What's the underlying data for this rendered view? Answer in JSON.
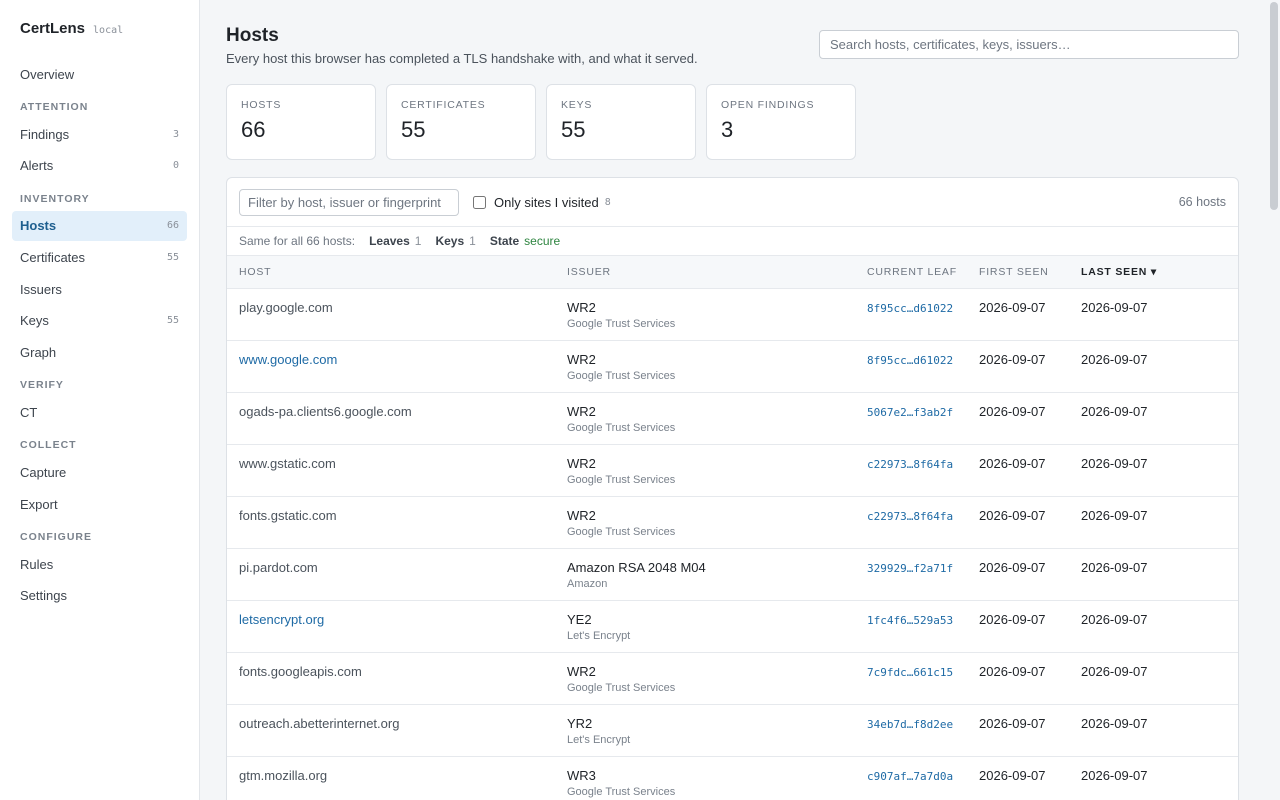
{
  "app": {
    "name": "CertLens",
    "tag": "local"
  },
  "sidebar": {
    "overview": "Overview",
    "sections": [
      {
        "title": "ATTENTION",
        "items": [
          {
            "label": "Findings",
            "count": "3"
          },
          {
            "label": "Alerts",
            "count": "0"
          }
        ]
      },
      {
        "title": "INVENTORY",
        "items": [
          {
            "label": "Hosts",
            "count": "66",
            "active": true
          },
          {
            "label": "Certificates",
            "count": "55"
          },
          {
            "label": "Issuers",
            "count": ""
          },
          {
            "label": "Keys",
            "count": "55"
          },
          {
            "label": "Graph",
            "count": ""
          }
        ]
      },
      {
        "title": "VERIFY",
        "items": [
          {
            "label": "CT",
            "count": ""
          }
        ]
      },
      {
        "title": "COLLECT",
        "items": [
          {
            "label": "Capture",
            "count": ""
          },
          {
            "label": "Export",
            "count": ""
          }
        ]
      },
      {
        "title": "CONFIGURE",
        "items": [
          {
            "label": "Rules",
            "count": ""
          },
          {
            "label": "Settings",
            "count": ""
          }
        ]
      }
    ]
  },
  "header": {
    "title": "Hosts",
    "subtitle": "Every host this browser has completed a TLS handshake with, and what it served.",
    "search_placeholder": "Search hosts, certificates, keys, issuers…"
  },
  "stats": [
    {
      "label": "HOSTS",
      "value": "66"
    },
    {
      "label": "CERTIFICATES",
      "value": "55"
    },
    {
      "label": "KEYS",
      "value": "55"
    },
    {
      "label": "OPEN FINDINGS",
      "value": "3"
    }
  ],
  "toolbar": {
    "filter_placeholder": "Filter by host, issuer or fingerprint",
    "visited_label": "Only sites I visited",
    "visited_count": "8",
    "host_total": "66 hosts"
  },
  "summary": {
    "lead": "Same for all 66 hosts:",
    "leaves_label": "Leaves",
    "leaves_value": "1",
    "keys_label": "Keys",
    "keys_value": "1",
    "state_label": "State",
    "state_value": "secure"
  },
  "table": {
    "headers": {
      "host": "HOST",
      "issuer": "ISSUER",
      "leaf": "CURRENT LEAF",
      "first": "FIRST SEEN",
      "last": "LAST SEEN ▾"
    },
    "rows": [
      {
        "host": "play.google.com",
        "link": false,
        "issuer": "WR2",
        "org": "Google Trust Services",
        "leaf": "8f95cc…d61022",
        "first": "2026-09-07",
        "last": "2026-09-07"
      },
      {
        "host": "www.google.com",
        "link": true,
        "issuer": "WR2",
        "org": "Google Trust Services",
        "leaf": "8f95cc…d61022",
        "first": "2026-09-07",
        "last": "2026-09-07"
      },
      {
        "host": "ogads-pa.clients6.google.com",
        "link": false,
        "issuer": "WR2",
        "org": "Google Trust Services",
        "leaf": "5067e2…f3ab2f",
        "first": "2026-09-07",
        "last": "2026-09-07"
      },
      {
        "host": "www.gstatic.com",
        "link": false,
        "issuer": "WR2",
        "org": "Google Trust Services",
        "leaf": "c22973…8f64fa",
        "first": "2026-09-07",
        "last": "2026-09-07"
      },
      {
        "host": "fonts.gstatic.com",
        "link": false,
        "issuer": "WR2",
        "org": "Google Trust Services",
        "leaf": "c22973…8f64fa",
        "first": "2026-09-07",
        "last": "2026-09-07"
      },
      {
        "host": "pi.pardot.com",
        "link": false,
        "issuer": "Amazon RSA 2048 M04",
        "org": "Amazon",
        "leaf": "329929…f2a71f",
        "first": "2026-09-07",
        "last": "2026-09-07"
      },
      {
        "host": "letsencrypt.org",
        "link": true,
        "issuer": "YE2",
        "org": "Let's Encrypt",
        "leaf": "1fc4f6…529a53",
        "first": "2026-09-07",
        "last": "2026-09-07"
      },
      {
        "host": "fonts.googleapis.com",
        "link": false,
        "issuer": "WR2",
        "org": "Google Trust Services",
        "leaf": "7c9fdc…661c15",
        "first": "2026-09-07",
        "last": "2026-09-07"
      },
      {
        "host": "outreach.abetterinternet.org",
        "link": false,
        "issuer": "YR2",
        "org": "Let's Encrypt",
        "leaf": "34eb7d…f8d2ee",
        "first": "2026-09-07",
        "last": "2026-09-07"
      },
      {
        "host": "gtm.mozilla.org",
        "link": false,
        "issuer": "WR3",
        "org": "Google Trust Services",
        "leaf": "c907af…7a7d0a",
        "first": "2026-09-07",
        "last": "2026-09-07"
      }
    ]
  }
}
